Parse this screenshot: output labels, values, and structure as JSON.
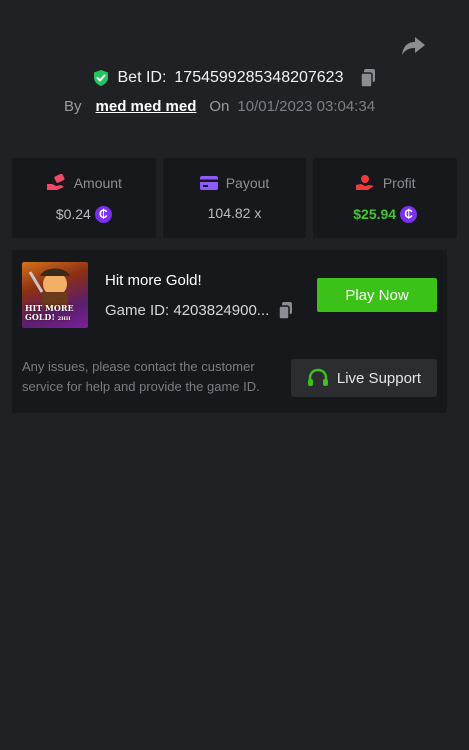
{
  "header": {
    "share_icon": "share-arrow-icon",
    "bet_label": "Bet ID:",
    "bet_id": "1754599285348207623",
    "by_label": "By",
    "username": "med med med",
    "on_label": "On",
    "datetime": "10/01/2023 03:04:34"
  },
  "stats": {
    "amount": {
      "label": "Amount",
      "value": "$0.24",
      "icon": "hand-money-icon"
    },
    "payout": {
      "label": "Payout",
      "value": "104.82 x",
      "icon": "card-icon"
    },
    "profit": {
      "label": "Profit",
      "value": "$25.94",
      "icon": "coin-hand-icon"
    },
    "coin_symbol": "₵"
  },
  "game": {
    "thumb_text_line1": "HIT MORE",
    "thumb_text_line2": "GOLD!",
    "thumb_text_badge": "2HH",
    "title": "Hit more Gold!",
    "game_id_label": "Game ID:",
    "game_id": "4203824900...",
    "play_label": "Play Now",
    "help_text": "Any issues, please contact the customer service for help and provide the game ID.",
    "support_label": "Live Support"
  },
  "colors": {
    "background": "#202125",
    "card": "#17181b",
    "play_button": "#3bc117",
    "profit_green": "#3ec92b",
    "coin_purple": "#7b2ff0",
    "shield_green": "#22c55e"
  }
}
